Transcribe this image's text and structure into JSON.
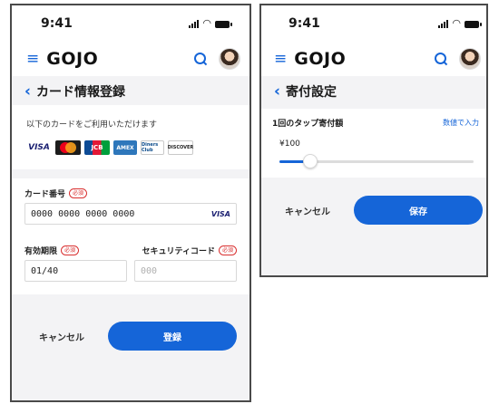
{
  "status": {
    "time": "9:41"
  },
  "app": {
    "logo": "GOJO"
  },
  "card_screen": {
    "title": "カード情報登録",
    "note": "以下のカードをご利用いただけます",
    "brands": [
      "VISA",
      "JCB",
      "AMEX",
      "Diners Club",
      "DISCOVER"
    ],
    "card_number": {
      "label": "カード番号",
      "required": "必須",
      "value": "0000 0000 0000 0000",
      "brand": "VISA"
    },
    "expiry": {
      "label": "有効期限",
      "required": "必須",
      "value": "01/40"
    },
    "security": {
      "label": "セキュリティコード",
      "required": "必須",
      "placeholder": "000"
    },
    "cancel": "キャンセル",
    "submit": "登録"
  },
  "donation_screen": {
    "title": "寄付設定",
    "tap_label": "1回のタップ寄付額",
    "input_link": "数値で入力",
    "amount": "¥100",
    "slider_fraction": 0.16,
    "cancel": "キャンセル",
    "save": "保存"
  },
  "colors": {
    "accent": "#1565d8",
    "required": "#d93030"
  }
}
